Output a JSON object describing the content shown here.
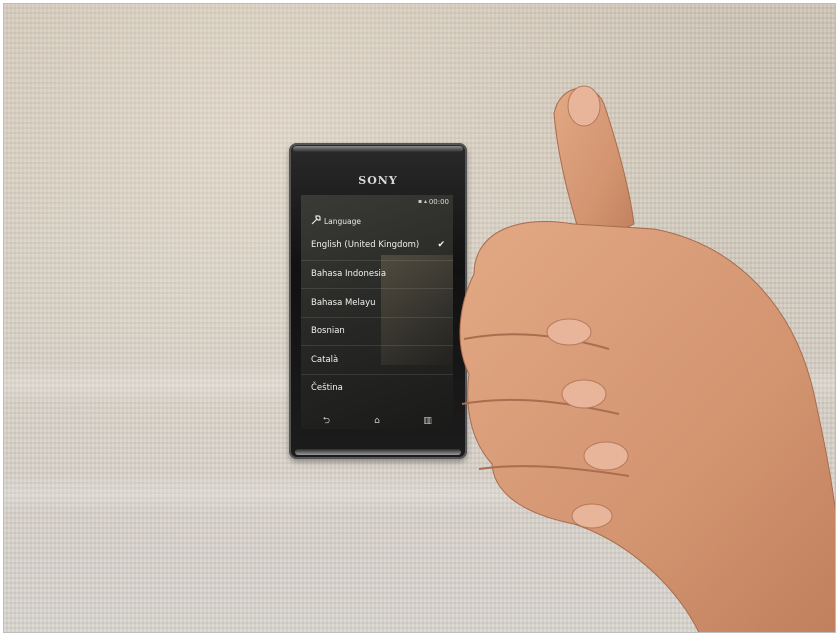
{
  "phone": {
    "brand": "SONY",
    "status_icons": "▪ ▴",
    "clock": "00:00",
    "action_bar": {
      "icon": "settings-wrench-icon",
      "title": "Language"
    },
    "languages": [
      {
        "label": "English (United Kingdom)",
        "selected": true
      },
      {
        "label": "Bahasa Indonesia",
        "selected": false
      },
      {
        "label": "Bahasa Melayu",
        "selected": false
      },
      {
        "label": "Bosnian",
        "selected": false
      },
      {
        "label": "Català",
        "selected": false
      },
      {
        "label": "Čeština",
        "selected": false
      }
    ],
    "check_glyph": "✔",
    "nav": {
      "back": "⮌",
      "home": "⌂",
      "recent": "▥"
    }
  },
  "colors": {
    "backdrop": "#d3cbbf",
    "skin": "#d99a73",
    "phone_body": "#141414"
  }
}
